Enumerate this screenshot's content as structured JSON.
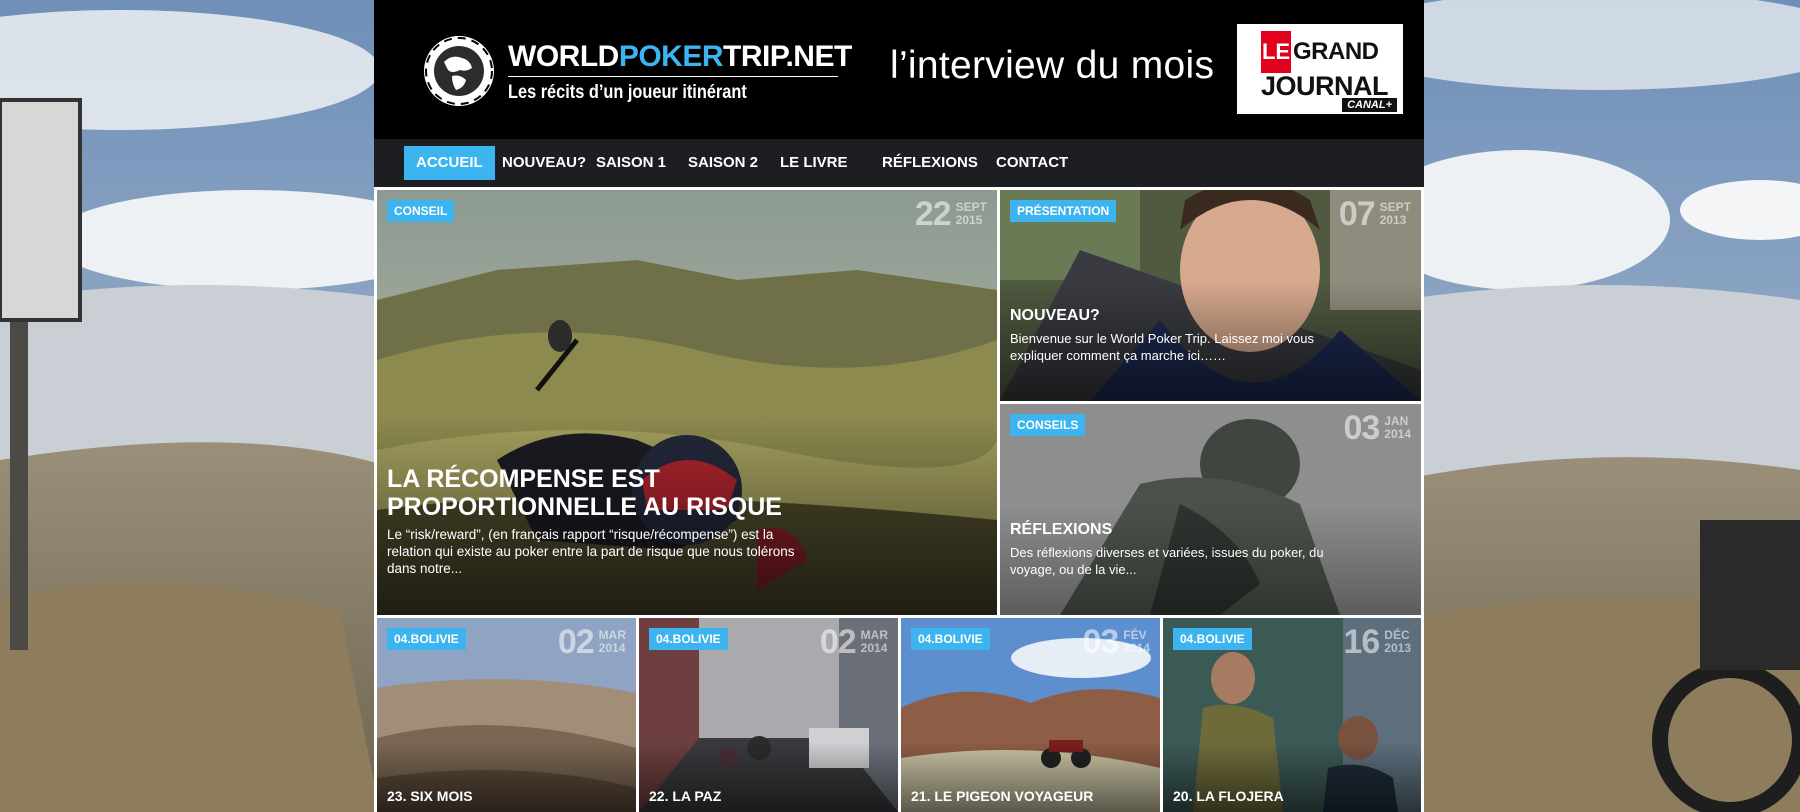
{
  "site": {
    "title_part1": "WORLD",
    "title_part2": "POKER",
    "title_part3": "TRIP.NET",
    "tagline": "Les récits d’un joueur itinérant",
    "logo_icon": "globe-poker-chip-icon",
    "interview_text": "l’interview du mois",
    "grand_journal": {
      "le": "LE",
      "grand": "GRAND",
      "journal": "JOURNAL",
      "canal": "CANAL+"
    }
  },
  "nav": {
    "items": [
      {
        "label": "ACCUEIL",
        "active": true
      },
      {
        "label": "NOUVEAU?"
      },
      {
        "label": "SAISON 1"
      },
      {
        "label": "SAISON 2"
      },
      {
        "label": "LE LIVRE"
      },
      {
        "label": "RÉFLEXIONS"
      },
      {
        "label": "CONTACT"
      }
    ]
  },
  "featured": [
    {
      "badge": "CONSEIL",
      "day": "22",
      "month": "SEPT",
      "year": "2015",
      "title_line1": "LA RÉCOMPENSE EST",
      "title_line2": "PROPORTIONNELLE AU RISQUE",
      "excerpt": "Le “risk/reward”, (en français rapport “risque/récompense”) est la relation qui existe au poker entre la part de risque que nous tolérons dans notre..."
    },
    {
      "badge": "PRÉSENTATION",
      "day": "07",
      "month": "SEPT",
      "year": "2013",
      "title": "NOUVEAU?",
      "excerpt": "Bienvenue sur le World Poker Trip. Laissez moi vous expliquer comment ça marche ici……"
    },
    {
      "badge": "CONSEILS",
      "day": "03",
      "month": "JAN",
      "year": "2014",
      "title": "RÉFLEXIONS",
      "excerpt": "Des réflexions diverses et variées, issues du poker, du voyage, ou de la vie..."
    }
  ],
  "posts": [
    {
      "badge": "04.BOLIVIE",
      "day": "02",
      "month": "MAR",
      "year": "2014",
      "title": "23. SIX MOIS"
    },
    {
      "badge": "04.BOLIVIE",
      "day": "02",
      "month": "MAR",
      "year": "2014",
      "title": "22. LA PAZ"
    },
    {
      "badge": "04.BOLIVIE",
      "day": "03",
      "month": "FÉV",
      "year": "2014",
      "title": "21. LE PIGEON VOYAGEUR"
    },
    {
      "badge": "04.BOLIVIE",
      "day": "16",
      "month": "DÉC",
      "year": "2013",
      "title": "20. LA FLOJERA"
    }
  ],
  "colors": {
    "accent": "#3cb4ef",
    "header_bg": "#000000",
    "nav_bg": "#1d1e22",
    "grand_journal_red": "#e2001a"
  }
}
